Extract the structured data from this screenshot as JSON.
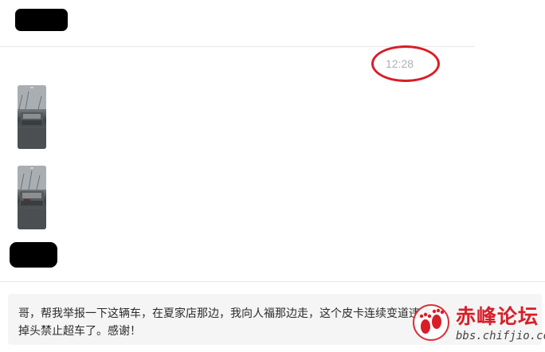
{
  "chat": {
    "timestamp": "12:28",
    "images": [
      {
        "icon": "truck-photo-thumbnail"
      },
      {
        "icon": "truck-photo-thumbnail"
      }
    ],
    "message_text": "哥，帮我举报一下这辆车，在夏家店那边，我向人福那边走，这个皮卡连续变道违法掉头禁止超车了。感谢！"
  },
  "annotation": {
    "color": "#d81e28"
  },
  "watermark": {
    "title": "赤峰论坛",
    "url": "bbs.chifjio.com",
    "logo_icon": "footprint-icon"
  }
}
